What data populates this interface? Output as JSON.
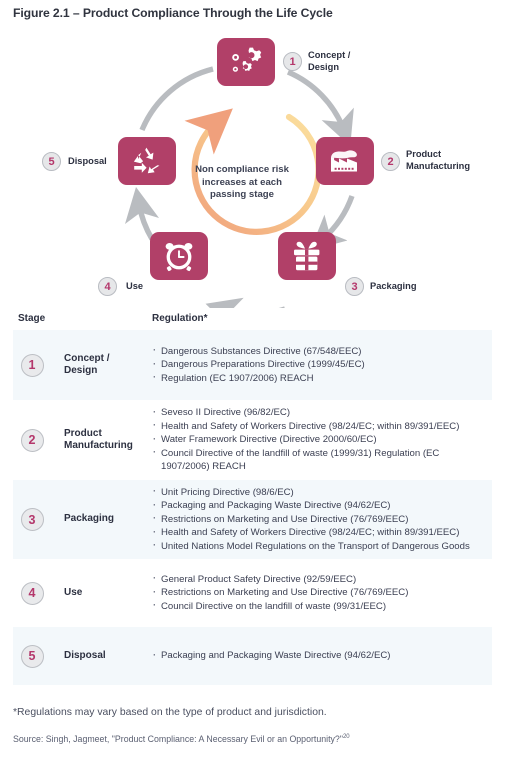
{
  "figure": {
    "title": "Figure 2.1 – Product Compliance Through the Life Cycle"
  },
  "colors": {
    "node_fill": "#b14068",
    "badge_fill": "#e6e7e9",
    "badge_border": "#b9bcc2",
    "badge_text": "#b4376b",
    "ring": "#b9bcc0",
    "row_shade": "#f3f8fb",
    "inner_arc_start": "#f0a07c",
    "inner_arc_end": "#fbd98a",
    "text": "#2c3040"
  },
  "diagram": {
    "center_text": "Non compliance risk\nincreases at each\npassing stage",
    "nodes": [
      {
        "number": "1",
        "label": "Concept /\nDesign",
        "icon": "gears-icon"
      },
      {
        "number": "2",
        "label": "Product\nManufacturing",
        "icon": "factory-icon"
      },
      {
        "number": "3",
        "label": "Packaging",
        "icon": "gift-icon"
      },
      {
        "number": "4",
        "label": "Use",
        "icon": "alarm-clock-icon"
      },
      {
        "number": "5",
        "label": "Disposal",
        "icon": "recycle-icon"
      }
    ]
  },
  "table": {
    "headers": {
      "stage": "Stage",
      "regulation": "Regulation*"
    },
    "rows": [
      {
        "number": "1",
        "stage": "Concept /\nDesign",
        "regulations": [
          "Dangerous Substances Directive (67/548/EEC)",
          "Dangerous Preparations Directive (1999/45/EC)",
          "Regulation (EC 1907/2006) REACH"
        ]
      },
      {
        "number": "2",
        "stage": "Product\nManufacturing",
        "regulations": [
          "Seveso II Directive (96/82/EC)",
          "Health and Safety of Workers Directive (98/24/EC; within 89/391/EEC)",
          "Water Framework Directive (Directive 2000/60/EC)",
          "Council Directive of the landfill of waste (1999/31) Regulation (EC 1907/2006) REACH"
        ]
      },
      {
        "number": "3",
        "stage": "Packaging",
        "regulations": [
          "Unit Pricing Directive (98/6/EC)",
          "Packaging and Packaging Waste Directive (94/62/EC)",
          "Restrictions on Marketing and Use Directive (76/769/EEC)",
          "Health and Safety of Workers Directive (98/24/EC; within 89/391/EEC)",
          "United Nations Model Regulations on the Transport of Dangerous Goods"
        ]
      },
      {
        "number": "4",
        "stage": "Use",
        "regulations": [
          "General Product Safety Directive (92/59/EEC)",
          "Restrictions on Marketing and Use Directive (76/769/EEC)",
          "Council Directive on the landfill of waste  (99/31/EEC)"
        ]
      },
      {
        "number": "5",
        "stage": "Disposal",
        "regulations": [
          "Packaging and Packaging Waste Directive (94/62/EC)"
        ]
      }
    ]
  },
  "footnotes": {
    "asterisk": "*Regulations may vary based on the type of product and jurisdiction.",
    "source": "Source: Singh, Jagmeet, \"Product Compliance: A Necessary Evil or an Opportunity?\"",
    "source_superscript": "20"
  }
}
